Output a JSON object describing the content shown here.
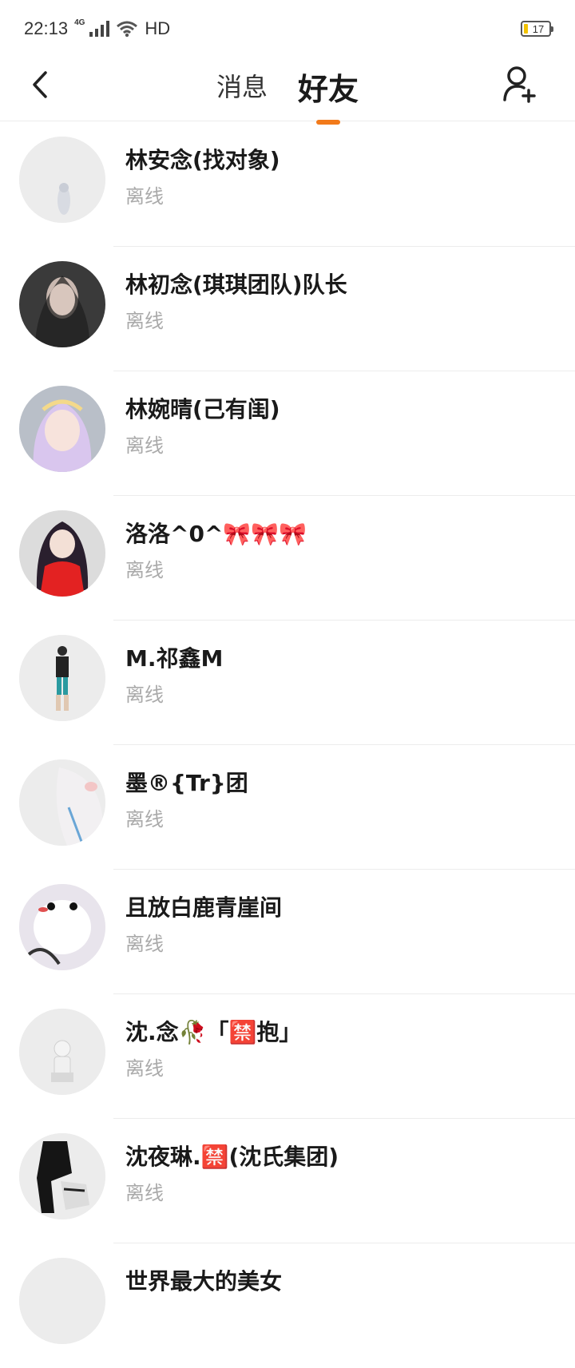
{
  "status_bar": {
    "time": "22:13",
    "network_type": "4G",
    "hd_label": "HD",
    "battery_level": "17"
  },
  "nav": {
    "back_icon": "back-chevron-icon",
    "tabs": [
      {
        "label": "消息",
        "active": false
      },
      {
        "label": "好友",
        "active": true
      }
    ],
    "add_friend_icon": "add-user-icon",
    "accent_color": "#f27a1a"
  },
  "friends": [
    {
      "name": "林安念(找对象)",
      "status": "离线"
    },
    {
      "name": "林初念(琪琪团队)队长",
      "status": "离线"
    },
    {
      "name": "林婉晴(己有闺)",
      "status": "离线"
    },
    {
      "name": "洛洛^0^🎀🎀🎀",
      "status": "离线"
    },
    {
      "name": "M.祁鑫M",
      "status": "离线"
    },
    {
      "name": "墨®{Tr}团",
      "status": "离线"
    },
    {
      "name": "且放白鹿青崖间",
      "status": "离线"
    },
    {
      "name": "沈.念🥀「🈲抱」",
      "status": "离线"
    },
    {
      "name": "沈夜琳.🈲(沈氏集团)",
      "status": "离线"
    },
    {
      "name": "世界最大的美女",
      "status": ""
    }
  ]
}
